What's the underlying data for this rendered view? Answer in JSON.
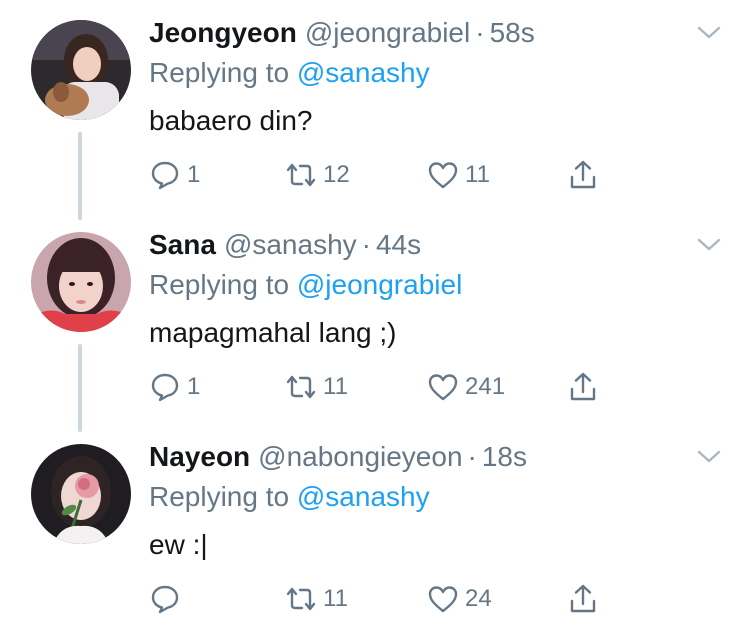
{
  "tweets": [
    {
      "name": "Jeongyeon",
      "handle": "@jeongrabiel",
      "separator": "·",
      "time": "58s",
      "replying_prefix": "Replying to",
      "replying_to": "@sanashy",
      "text": "babaero din?",
      "replies": "1",
      "retweets": "12",
      "likes": "11"
    },
    {
      "name": "Sana",
      "handle": "@sanashy",
      "separator": "·",
      "time": "44s",
      "replying_prefix": "Replying to",
      "replying_to": "@jeongrabiel",
      "text": "mapagmahal lang ;)",
      "replies": "1",
      "retweets": "11",
      "likes": "241"
    },
    {
      "name": "Nayeon",
      "handle": "@nabongieyeon",
      "separator": "·",
      "time": "18s",
      "replying_prefix": "Replying to",
      "replying_to": "@sanashy",
      "text": "ew :|",
      "replies": "",
      "retweets": "11",
      "likes": "24"
    }
  ],
  "icons": {
    "reply": "reply-icon",
    "retweet": "retweet-icon",
    "like": "heart-icon",
    "share": "share-icon",
    "menu": "chevron-down-icon"
  },
  "colors": {
    "name": "#14171a",
    "secondary": "#657786",
    "link": "#1da1f2",
    "thread_line": "#ccd6dd"
  }
}
